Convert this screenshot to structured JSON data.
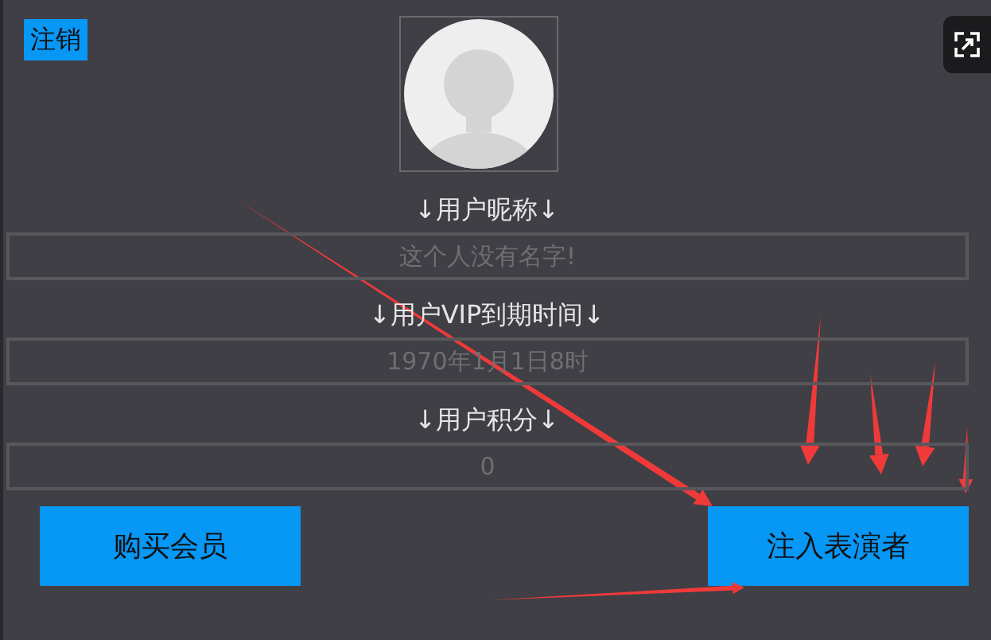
{
  "logout_button": "注销",
  "fields": [
    {
      "label": "↓用户昵称↓",
      "value": "这个人没有名字!"
    },
    {
      "label": "↓用户VIP到期时间↓",
      "value": "1970年1月1日8时"
    },
    {
      "label": "↓用户积分↓",
      "value": "0"
    }
  ],
  "buttons": [
    "购买会员",
    "注入表演者"
  ]
}
